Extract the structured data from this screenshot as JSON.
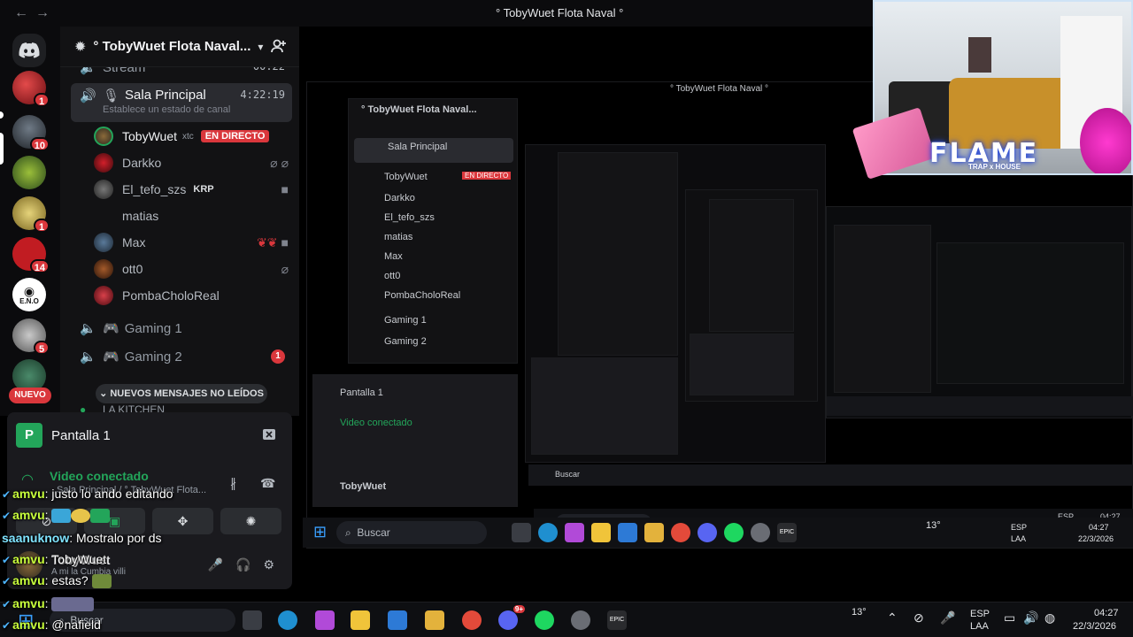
{
  "window": {
    "title": "° TobyWuet Flota Naval °"
  },
  "guild": {
    "name": "° TobyWuet Flota Naval..."
  },
  "servers": [
    {
      "badge": "1"
    },
    {
      "badge": "10"
    },
    {
      "badge": ""
    },
    {
      "badge": "1"
    },
    {
      "badge": "14"
    },
    {
      "badge": ""
    },
    {
      "badge": "5"
    },
    {
      "badge": ""
    }
  ],
  "rail": {
    "new_label": "NUEVO",
    "eno_label": "E.N.O"
  },
  "channels": {
    "stream": "Stream",
    "stream_time": "00:22",
    "sala": "Sala Principal",
    "sala_time": "4:22:19",
    "sala_status": "Establece un estado de canal",
    "gaming1": "Gaming 1",
    "gaming2": "Gaming 2",
    "gaming2_unread": "1",
    "lakitchen": "LA KITCHEN"
  },
  "users": [
    {
      "name": "TobyWuet",
      "tag": "xtc",
      "live": "EN DIRECTO"
    },
    {
      "name": "Darkko"
    },
    {
      "name": "El_tefo_szs",
      "badge": "KRP"
    },
    {
      "name": "matias"
    },
    {
      "name": "Max"
    },
    {
      "name": "ott0"
    },
    {
      "name": "PombaCholoReal"
    }
  ],
  "new_messages": "NUEVOS MENSAJES NO LEÍDOS",
  "voice_panel": {
    "stream_title": "Pantalla 1",
    "connected": "Video conectado",
    "location": "Sala Principal / ° TobyWuet Flota...",
    "user_name": "TobyWuet",
    "user_status": "A mi la Cumbia villi"
  },
  "chat": [
    {
      "user": "amvu",
      "text": "justo lo ando editando"
    },
    {
      "user": "amvu",
      "text": ""
    },
    {
      "user": "saanuknow",
      "text": "Mostralo por ds"
    },
    {
      "user": "amvu",
      "text": "TobyWuet"
    },
    {
      "user": "amvu",
      "text": "estas?"
    },
    {
      "user": "amvu",
      "text": ""
    },
    {
      "user": "amvu",
      "text": "@nafield"
    }
  ],
  "taskbar": {
    "search": "Buscar",
    "lang": "ESP",
    "region": "LAA",
    "time": "04:27",
    "date": "22/3/2026",
    "temp": "13°",
    "discord_badge": "9+"
  },
  "nested": {
    "time": "04:27",
    "date": "22/3/2026",
    "search": "Buscar"
  },
  "overlay": {
    "flame": "FLAME",
    "flame_sub": "TRAP x HOUSE"
  },
  "colors": {
    "accent_green": "#23a55a",
    "danger_red": "#da373c",
    "bg_dark": "#121214"
  }
}
